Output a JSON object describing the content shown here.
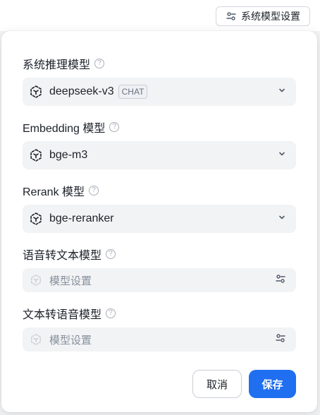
{
  "header": {
    "system_model_button": "系统模型设置"
  },
  "sections": [
    {
      "label": "系统推理模型",
      "value": "deepseek-v3",
      "tag": "CHAT"
    },
    {
      "label": "Embedding 模型",
      "value": "bge-m3"
    },
    {
      "label": "Rerank 模型",
      "value": "bge-reranker"
    },
    {
      "label": "语音转文本模型",
      "placeholder": "模型设置"
    },
    {
      "label": "文本转语音模型",
      "placeholder": "模型设置"
    }
  ],
  "footer": {
    "cancel_label": "取消",
    "save_label": "保存"
  },
  "colors": {
    "primary": "#1f6ff0",
    "field_bg": "#f2f3f5",
    "muted": "#86909c"
  }
}
